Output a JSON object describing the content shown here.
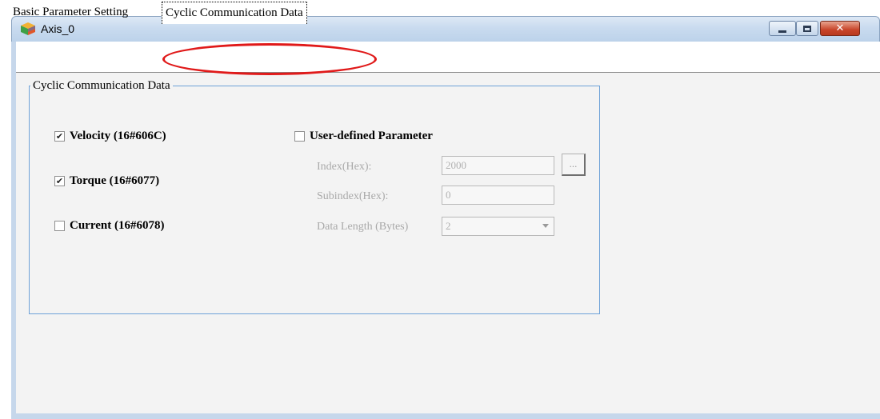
{
  "window": {
    "title": "Axis_0",
    "close_glyph": "✕"
  },
  "tabs": [
    {
      "label": "Basic Parameter Setting",
      "active": false
    },
    {
      "label": "Cyclic Communication Data",
      "active": true
    }
  ],
  "group": {
    "legend": "Cyclic Communication Data",
    "checkboxes": [
      {
        "label": "Velocity (16#606C)",
        "checked": true
      },
      {
        "label": "Torque (16#6077)",
        "checked": true
      },
      {
        "label": "Current (16#6078)",
        "checked": false
      }
    ],
    "user_defined": {
      "label": "User-defined Parameter",
      "checked": false,
      "index_label": "Index(Hex):",
      "index_value": "2000",
      "browse_label": "...",
      "subindex_label": "Subindex(Hex):",
      "subindex_value": "0",
      "length_label": "Data Length (Bytes)",
      "length_value": "2"
    }
  },
  "colors": {
    "annotation_ellipse": "#e01919",
    "group_border": "#6ea2d8",
    "disabled_text": "#a9a9a9"
  },
  "icons": {
    "app": "colored-cube-icon",
    "check": "check-mark-icon"
  }
}
